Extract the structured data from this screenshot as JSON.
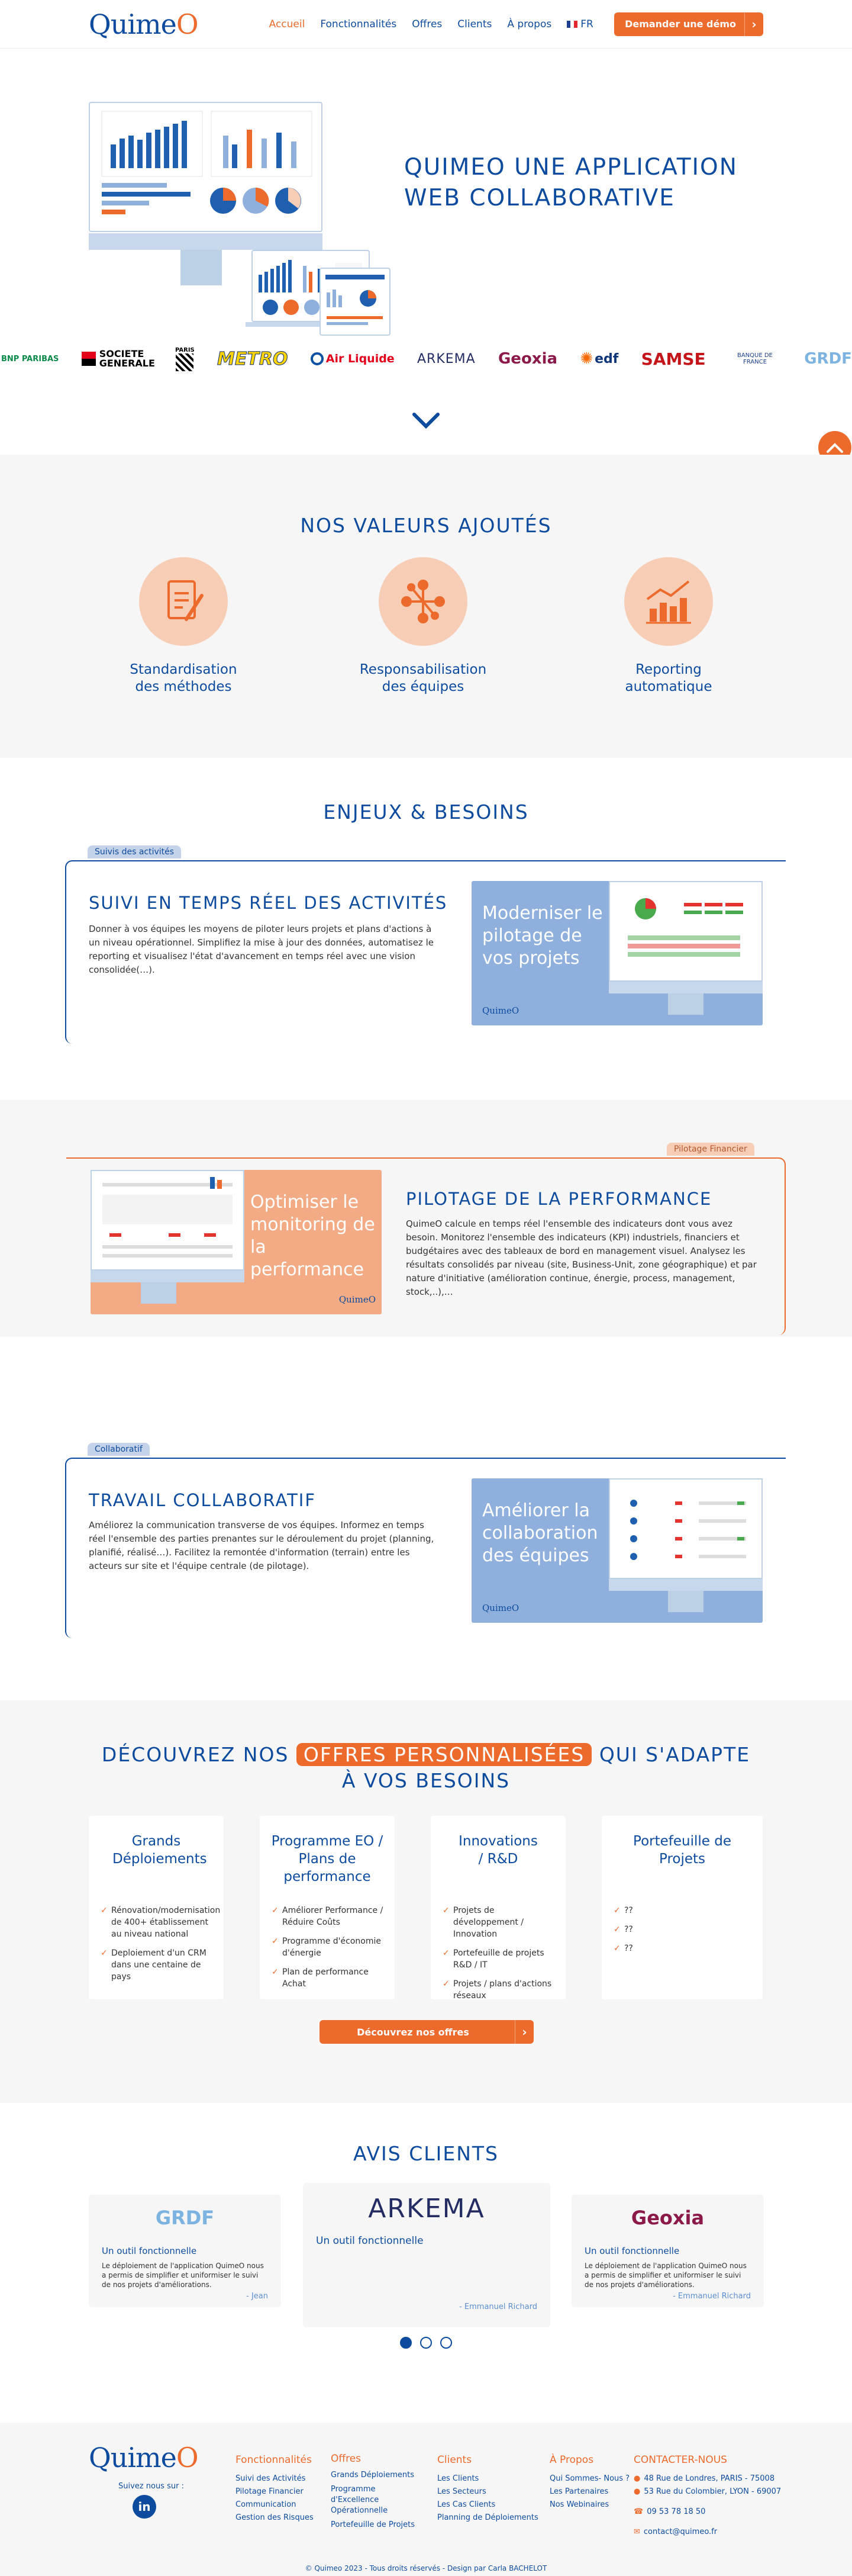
{
  "header": {
    "logo_main": "Quime",
    "logo_o": "O",
    "nav": [
      "Accueil",
      "Fonctionnalités",
      "Offres",
      "Clients",
      "À propos"
    ],
    "lang": "FR",
    "cta": "Demander une démo",
    "cta_arrow": "›"
  },
  "hero": {
    "title_line1": "QUIMEO UNE APPLICATION",
    "title_line2": "WEB COLLABORATIVE"
  },
  "client_logos": [
    "BNP PARIBAS",
    "SOCIETE GENERALE",
    "PARIS",
    "METRO",
    "Air Liquide",
    "ARKEMA",
    "Geoxia",
    "edf",
    "SAMSE",
    "BANQUE DE FRANCE",
    "GRDF"
  ],
  "valeurs": {
    "title": "NOS VALEURS AJOUTÉS",
    "items": [
      {
        "line1": "Standardisation",
        "line2": "des méthodes",
        "icon": "document-pen-icon"
      },
      {
        "line1": "Responsabilisation",
        "line2": "des équipes",
        "icon": "team-network-icon"
      },
      {
        "line1": "Reporting",
        "line2": "automatique",
        "icon": "bar-chart-up-icon"
      }
    ]
  },
  "enjeux": {
    "title": "ENJEUX & BESOINS",
    "blocks": [
      {
        "tag": "Suivis des activités",
        "title": "SUIVI EN TEMPS RÉEL DES ACTIVITÉS",
        "text": "Donner à vos équipes les moyens de piloter leurs projets et plans d'actions à un niveau opérationnel. Simplifiez la mise à jour des données, automatisez le reporting et visualisez l'état d'avancement en temps réel avec une vision consolidée(…).",
        "shot_label": "Moderniser le pilotage de vos projets",
        "shot_logo": "QuimeO"
      },
      {
        "tag": "Pilotage Financier",
        "title": "PILOTAGE DE LA PERFORMANCE",
        "text": "QuimeO calcule en temps réel l'ensemble des indicateurs dont vous avez besoin. Monitorez l'ensemble des indicateurs (KPI) industriels, financiers et budgétaires avec des tableaux de bord en management visuel. Analysez les résultats consolidés par niveau (site, Business-Unit, zone géographique) et par nature d'initiative (amélioration continue, énergie, process, management, stock,..),…",
        "shot_label": "Optimiser le monitoring de la performance",
        "shot_logo": "QuimeO"
      },
      {
        "tag": "Collaboratif",
        "title": "TRAVAIL COLLABORATIF",
        "text": "Améliorez la communication transverse de vos équipes. Informez en temps réel l'ensemble des parties prenantes sur le déroulement du projet (planning, planifié, réalisé…). Facilitez la remontée d'information (terrain) entre les acteurs sur site et l'équipe centrale (de pilotage).",
        "shot_label": "Améliorer la collaboration des équipes",
        "shot_logo": "QuimeO"
      }
    ]
  },
  "offres": {
    "title_pre": "DÉCOUVREZ NOS",
    "title_highlight": "OFFRES PERSONNALISÉES",
    "title_post": "QUI S'ADAPTE",
    "title_line2": "À VOS BESOINS",
    "cards": [
      {
        "title": "Grands Déploiements",
        "items": [
          "Rénovation/modernisation de 400+ établissement au niveau national",
          "Deploiement d'un CRM dans une centaine de pays"
        ]
      },
      {
        "title": "Programme EO / Plans de performance",
        "items": [
          "Améliorer Performance / Réduire Coûts",
          "Programme d'économie d'énergie",
          "Plan de performance Achat"
        ]
      },
      {
        "title": "Innovations / R&D",
        "items": [
          "Projets de développement / Innovation",
          "Portefeuille de projets R&D / IT",
          "Projets / plans d'actions réseaux"
        ]
      },
      {
        "title": "Portefeuille de Projets",
        "items": [
          "??",
          "??",
          "??"
        ]
      }
    ],
    "cta": "Découvrez nos offres",
    "cta_arrow": "›"
  },
  "avis": {
    "title": "AVIS CLIENTS",
    "cards": [
      {
        "logo": "GRDF",
        "title": "Un outil fonctionnelle",
        "text": "Le déploiement de l'application QuimeO nous a permis de simplifier et uniformiser le suivi de nos projets d'améliorations.",
        "author": "- Jean"
      },
      {
        "logo": "ARKEMA",
        "title": "Un outil fonctionnelle",
        "text": "",
        "author": "- Emmanuel Richard"
      },
      {
        "logo": "Geoxia",
        "title": "Un outil fonctionnelle",
        "text": "Le déploiement de l'application QuimeO nous a permis de simplifier et uniformiser le suivi de nos projets d'améliorations.",
        "author": "- Emmanuel Richard"
      }
    ]
  },
  "footer": {
    "follow": "Suivez nous sur :",
    "linkedin": "in",
    "cols": [
      {
        "title": "Fonctionnalités",
        "items": [
          "Suivi des Activités",
          "Pilotage Financier",
          "Communication",
          "Gestion des Risques"
        ]
      },
      {
        "title": "Offres",
        "items": [
          "Grands Déploiements",
          "Programme d'Excellence Opérationnelle",
          "Portefeuille de Projets"
        ]
      },
      {
        "title": "Clients",
        "items": [
          "Les Clients",
          "Les Secteurs",
          "Les Cas Clients",
          "Planning de Déploiements"
        ]
      },
      {
        "title": "À Propos",
        "items": [
          "Qui Sommes- Nous ?",
          "Les Partenaires",
          "Nos Webinaires"
        ]
      }
    ],
    "contact_title": "CONTACTER-NOUS",
    "address1": "48 Rue de Londres, PARIS - 75008",
    "address2": "53 Rue du Colombier, LYON - 69007",
    "phone": "09 53 78 18 50",
    "email": "contact@quimeo.fr",
    "copyright": "© Quimeo 2023 - Tous droits réservés - Design par Carla BACHELOT"
  },
  "colors": {
    "navy": "#0d4b9e",
    "orange": "#ec6a2c",
    "peach": "#f7cdb5",
    "light_blue": "#8fafdc"
  }
}
